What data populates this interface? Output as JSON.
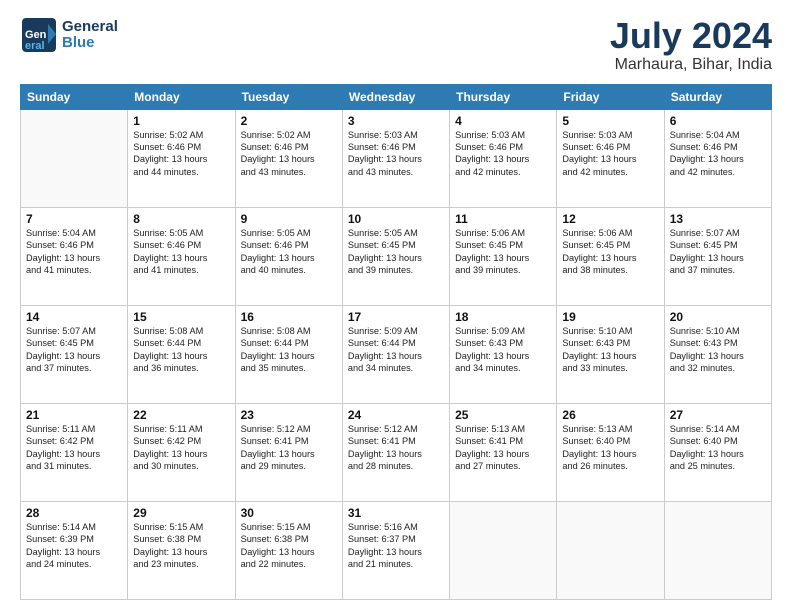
{
  "header": {
    "logo_line1": "General",
    "logo_line2": "Blue",
    "main_title": "July 2024",
    "subtitle": "Marhaura, Bihar, India"
  },
  "days_of_week": [
    "Sunday",
    "Monday",
    "Tuesday",
    "Wednesday",
    "Thursday",
    "Friday",
    "Saturday"
  ],
  "weeks": [
    [
      {
        "day": "",
        "info": ""
      },
      {
        "day": "1",
        "info": "Sunrise: 5:02 AM\nSunset: 6:46 PM\nDaylight: 13 hours\nand 44 minutes."
      },
      {
        "day": "2",
        "info": "Sunrise: 5:02 AM\nSunset: 6:46 PM\nDaylight: 13 hours\nand 43 minutes."
      },
      {
        "day": "3",
        "info": "Sunrise: 5:03 AM\nSunset: 6:46 PM\nDaylight: 13 hours\nand 43 minutes."
      },
      {
        "day": "4",
        "info": "Sunrise: 5:03 AM\nSunset: 6:46 PM\nDaylight: 13 hours\nand 42 minutes."
      },
      {
        "day": "5",
        "info": "Sunrise: 5:03 AM\nSunset: 6:46 PM\nDaylight: 13 hours\nand 42 minutes."
      },
      {
        "day": "6",
        "info": "Sunrise: 5:04 AM\nSunset: 6:46 PM\nDaylight: 13 hours\nand 42 minutes."
      }
    ],
    [
      {
        "day": "7",
        "info": "Sunrise: 5:04 AM\nSunset: 6:46 PM\nDaylight: 13 hours\nand 41 minutes."
      },
      {
        "day": "8",
        "info": "Sunrise: 5:05 AM\nSunset: 6:46 PM\nDaylight: 13 hours\nand 41 minutes."
      },
      {
        "day": "9",
        "info": "Sunrise: 5:05 AM\nSunset: 6:46 PM\nDaylight: 13 hours\nand 40 minutes."
      },
      {
        "day": "10",
        "info": "Sunrise: 5:05 AM\nSunset: 6:45 PM\nDaylight: 13 hours\nand 39 minutes."
      },
      {
        "day": "11",
        "info": "Sunrise: 5:06 AM\nSunset: 6:45 PM\nDaylight: 13 hours\nand 39 minutes."
      },
      {
        "day": "12",
        "info": "Sunrise: 5:06 AM\nSunset: 6:45 PM\nDaylight: 13 hours\nand 38 minutes."
      },
      {
        "day": "13",
        "info": "Sunrise: 5:07 AM\nSunset: 6:45 PM\nDaylight: 13 hours\nand 37 minutes."
      }
    ],
    [
      {
        "day": "14",
        "info": "Sunrise: 5:07 AM\nSunset: 6:45 PM\nDaylight: 13 hours\nand 37 minutes."
      },
      {
        "day": "15",
        "info": "Sunrise: 5:08 AM\nSunset: 6:44 PM\nDaylight: 13 hours\nand 36 minutes."
      },
      {
        "day": "16",
        "info": "Sunrise: 5:08 AM\nSunset: 6:44 PM\nDaylight: 13 hours\nand 35 minutes."
      },
      {
        "day": "17",
        "info": "Sunrise: 5:09 AM\nSunset: 6:44 PM\nDaylight: 13 hours\nand 34 minutes."
      },
      {
        "day": "18",
        "info": "Sunrise: 5:09 AM\nSunset: 6:43 PM\nDaylight: 13 hours\nand 34 minutes."
      },
      {
        "day": "19",
        "info": "Sunrise: 5:10 AM\nSunset: 6:43 PM\nDaylight: 13 hours\nand 33 minutes."
      },
      {
        "day": "20",
        "info": "Sunrise: 5:10 AM\nSunset: 6:43 PM\nDaylight: 13 hours\nand 32 minutes."
      }
    ],
    [
      {
        "day": "21",
        "info": "Sunrise: 5:11 AM\nSunset: 6:42 PM\nDaylight: 13 hours\nand 31 minutes."
      },
      {
        "day": "22",
        "info": "Sunrise: 5:11 AM\nSunset: 6:42 PM\nDaylight: 13 hours\nand 30 minutes."
      },
      {
        "day": "23",
        "info": "Sunrise: 5:12 AM\nSunset: 6:41 PM\nDaylight: 13 hours\nand 29 minutes."
      },
      {
        "day": "24",
        "info": "Sunrise: 5:12 AM\nSunset: 6:41 PM\nDaylight: 13 hours\nand 28 minutes."
      },
      {
        "day": "25",
        "info": "Sunrise: 5:13 AM\nSunset: 6:41 PM\nDaylight: 13 hours\nand 27 minutes."
      },
      {
        "day": "26",
        "info": "Sunrise: 5:13 AM\nSunset: 6:40 PM\nDaylight: 13 hours\nand 26 minutes."
      },
      {
        "day": "27",
        "info": "Sunrise: 5:14 AM\nSunset: 6:40 PM\nDaylight: 13 hours\nand 25 minutes."
      }
    ],
    [
      {
        "day": "28",
        "info": "Sunrise: 5:14 AM\nSunset: 6:39 PM\nDaylight: 13 hours\nand 24 minutes."
      },
      {
        "day": "29",
        "info": "Sunrise: 5:15 AM\nSunset: 6:38 PM\nDaylight: 13 hours\nand 23 minutes."
      },
      {
        "day": "30",
        "info": "Sunrise: 5:15 AM\nSunset: 6:38 PM\nDaylight: 13 hours\nand 22 minutes."
      },
      {
        "day": "31",
        "info": "Sunrise: 5:16 AM\nSunset: 6:37 PM\nDaylight: 13 hours\nand 21 minutes."
      },
      {
        "day": "",
        "info": ""
      },
      {
        "day": "",
        "info": ""
      },
      {
        "day": "",
        "info": ""
      }
    ]
  ]
}
